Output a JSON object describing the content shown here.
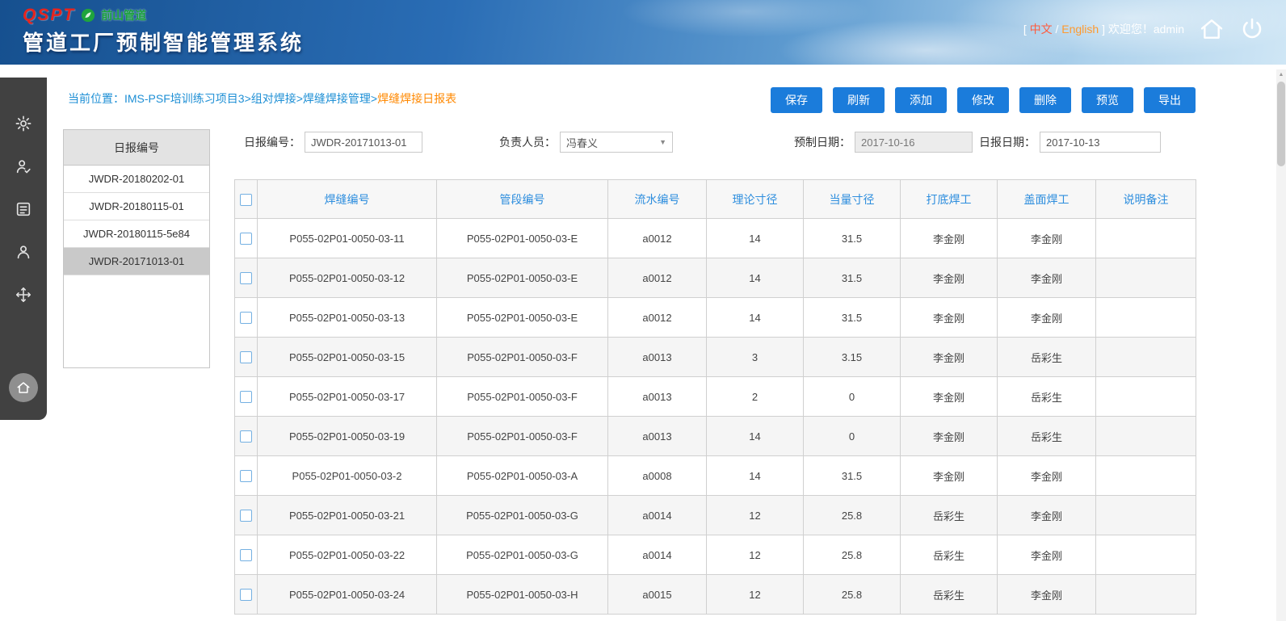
{
  "header": {
    "logo_text": "QSPT",
    "logo_sub": "前山管道",
    "title": "管道工厂预制智能管理系统",
    "lang_prefix": "[",
    "lang_zh": "中文",
    "lang_divider": "/",
    "lang_en": "English",
    "lang_suffix": "]",
    "welcome_text": "欢迎您！admin"
  },
  "breadcrumb": {
    "label": "当前位置：",
    "path": "IMS-PSF培训练习项目3>组对焊接>焊缝焊接管理>",
    "current": "焊缝焊接日报表"
  },
  "toolbar": {
    "buttons": [
      "保存",
      "刷新",
      "添加",
      "修改",
      "删除",
      "预览",
      "导出"
    ]
  },
  "report_list": {
    "title": "日报编号",
    "items": [
      "JWDR-20180202-01",
      "JWDR-20180115-01",
      "JWDR-20180115-5e84",
      "JWDR-20171013-01"
    ],
    "selected_index": 3
  },
  "form": {
    "fields": [
      {
        "label": "日报编号：",
        "value": "JWDR-20171013-01"
      },
      {
        "label": "负责人员：",
        "value": "冯春义"
      },
      {
        "label": "预制日期：",
        "value": "2017-10-16"
      },
      {
        "label": "日报日期：",
        "value": "2017-10-13"
      }
    ],
    "select_arrow": "▼"
  },
  "table": {
    "columns": [
      "焊缝编号",
      "管段编号",
      "流水编号",
      "理论寸径",
      "当量寸径",
      "打底焊工",
      "盖面焊工",
      "说明备注"
    ],
    "rows": [
      [
        "P055-02P01-0050-03-11",
        "P055-02P01-0050-03-E",
        "a0012",
        "14",
        "31.5",
        "李金刚",
        "李金刚",
        ""
      ],
      [
        "P055-02P01-0050-03-12",
        "P055-02P01-0050-03-E",
        "a0012",
        "14",
        "31.5",
        "李金刚",
        "李金刚",
        ""
      ],
      [
        "P055-02P01-0050-03-13",
        "P055-02P01-0050-03-E",
        "a0012",
        "14",
        "31.5",
        "李金刚",
        "李金刚",
        ""
      ],
      [
        "P055-02P01-0050-03-15",
        "P055-02P01-0050-03-F",
        "a0013",
        "3",
        "3.15",
        "李金刚",
        "岳彩生",
        ""
      ],
      [
        "P055-02P01-0050-03-17",
        "P055-02P01-0050-03-F",
        "a0013",
        "2",
        "0",
        "李金刚",
        "岳彩生",
        ""
      ],
      [
        "P055-02P01-0050-03-19",
        "P055-02P01-0050-03-F",
        "a0013",
        "14",
        "0",
        "李金刚",
        "岳彩生",
        ""
      ],
      [
        "P055-02P01-0050-03-2",
        "P055-02P01-0050-03-A",
        "a0008",
        "14",
        "31.5",
        "李金刚",
        "李金刚",
        ""
      ],
      [
        "P055-02P01-0050-03-21",
        "P055-02P01-0050-03-G",
        "a0014",
        "12",
        "25.8",
        "岳彩生",
        "李金刚",
        ""
      ],
      [
        "P055-02P01-0050-03-22",
        "P055-02P01-0050-03-G",
        "a0014",
        "12",
        "25.8",
        "岳彩生",
        "李金刚",
        ""
      ],
      [
        "P055-02P01-0050-03-24",
        "P055-02P01-0050-03-H",
        "a0015",
        "12",
        "25.8",
        "岳彩生",
        "李金刚",
        ""
      ]
    ]
  },
  "colors": {
    "accent_blue": "#1b7cdb",
    "breadcrumb_blue": "#1e8fd5",
    "breadcrumb_orange": "#ff8800",
    "table_header_text": "#2e8ede",
    "sidebar_bg": "#414141",
    "selected_row_bg": "#c9c9c9"
  }
}
